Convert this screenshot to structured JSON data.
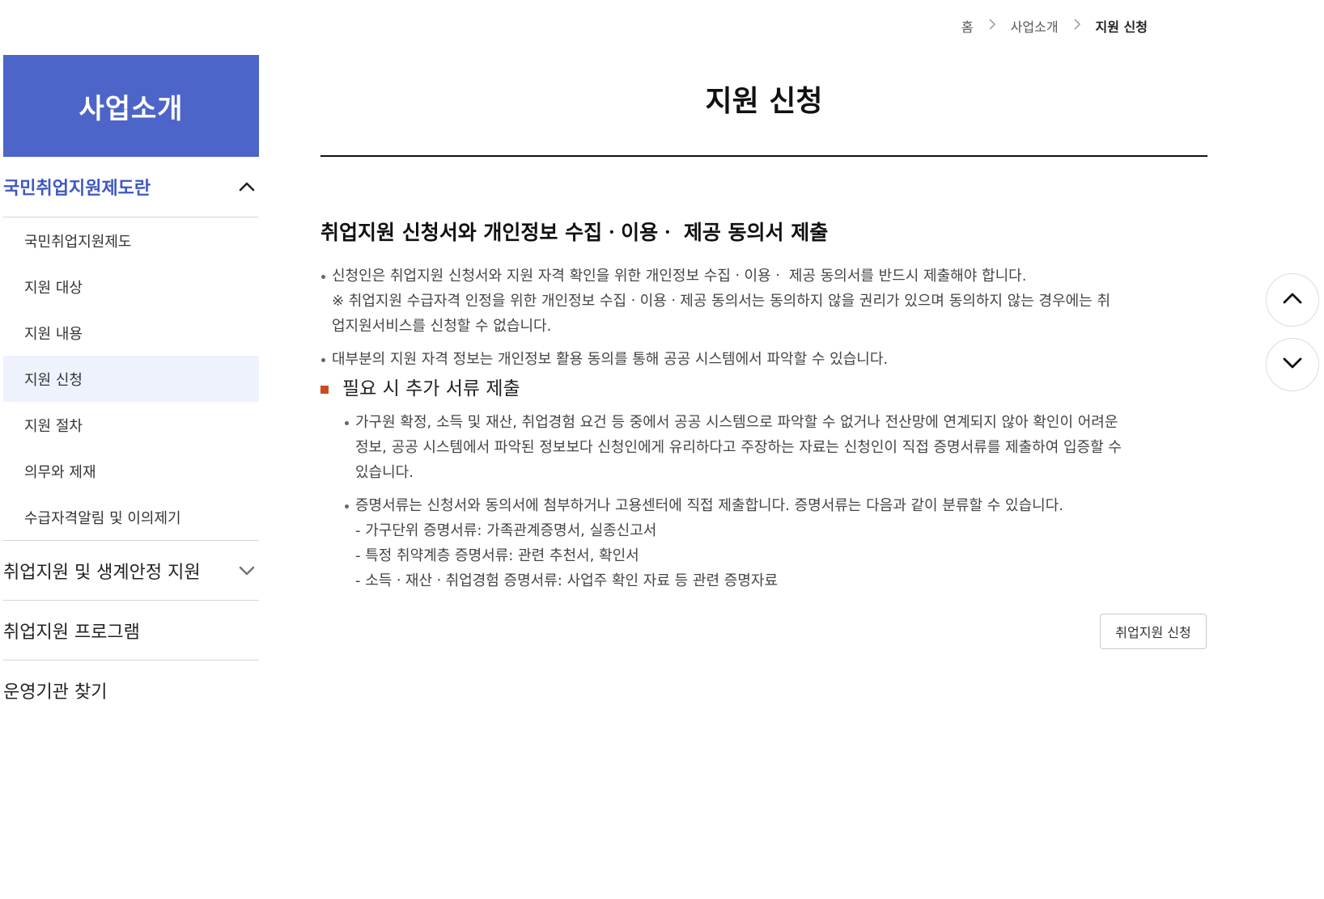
{
  "breadcrumb": {
    "home": "홈",
    "parent": "사업소개",
    "current": "지원 신청"
  },
  "sidebar": {
    "title": "사업소개",
    "group1": {
      "label": "국민취업지원제도란",
      "expanded": true
    },
    "sub_items": [
      {
        "label": "국민취업지원제도"
      },
      {
        "label": "지원 대상"
      },
      {
        "label": "지원 내용"
      },
      {
        "label": "지원 신청",
        "active": true
      },
      {
        "label": "지원 절차"
      },
      {
        "label": "의무와 제재"
      },
      {
        "label": "수급자격알림 및 이의제기"
      }
    ],
    "group2": {
      "label": "취업지원 및 생계안정 지원",
      "expanded": false
    },
    "group3": {
      "label": "취업지원 프로그램"
    },
    "group4": {
      "label": "운영기관 찾기"
    }
  },
  "main": {
    "title": "지원 신청",
    "section_heading": "취업지원 신청서와 개인정보 수집ㆍ이용ㆍ 제공 동의서 제출",
    "bullet1": "신청인은 취업지원 신청서와 지원 자격 확인을 위한 개인정보 수집ㆍ이용ㆍ 제공 동의서를 반드시 제출해야 합니다.",
    "bullet1_note_1": "※ 취업지원 수급자격 인정을 위한 개인정보 수집ㆍ이용ㆍ제공 동의서는 동의하지 않을 권리가 있으며 동의하지 않는 경우에는 취",
    "bullet1_note_2": "업지원서비스를 신청할 수 없습니다.",
    "bullet2": "대부분의 지원 자격 정보는 개인정보 활용 동의를 통해 공공 시스템에서 파악할 수 있습니다.",
    "sub_heading": "필요 시 추가 서류 제출",
    "sub_bullet1_line1": "가구원 확정, 소득 및 재산, 취업경험 요건 등 중에서 공공 시스템으로 파악할 수 없거나 전산망에 연계되지 않아 확인이 어려운",
    "sub_bullet1_line2": "정보, 공공 시스템에서 파악된 정보보다 신청인에게 유리하다고 주장하는 자료는 신청인이 직접 증명서류를 제출하여 입증할 수",
    "sub_bullet1_line3": "있습니다.",
    "sub_bullet2": "증명서류는 신청서와 동의서에 첨부하거나 고용센터에 직접 제출합니다. 증명서류는 다음과 같이 분류할 수 있습니다.",
    "doc_types": [
      "- 가구단위 증명서류: 가족관계증명서, 실종신고서",
      "- 특정 취약계층 증명서류: 관련 추천서, 확인서",
      "- 소득ㆍ재산ㆍ취업경험 증명서류: 사업주 확인 자료 등 관련 증명자료"
    ],
    "apply_button": "취업지원 신청"
  },
  "icons": {
    "breadcrumb_sep": "chevron-right-icon",
    "expand": "chevron-up-icon",
    "collapse": "chevron-down-icon",
    "scroll_up": "arrow-up-icon",
    "scroll_down": "arrow-down-icon"
  },
  "colors": {
    "accent": "#4d64c8",
    "active_text": "#3f58c2",
    "active_bg": "#eef2fd",
    "marker": "#c84e1f"
  }
}
